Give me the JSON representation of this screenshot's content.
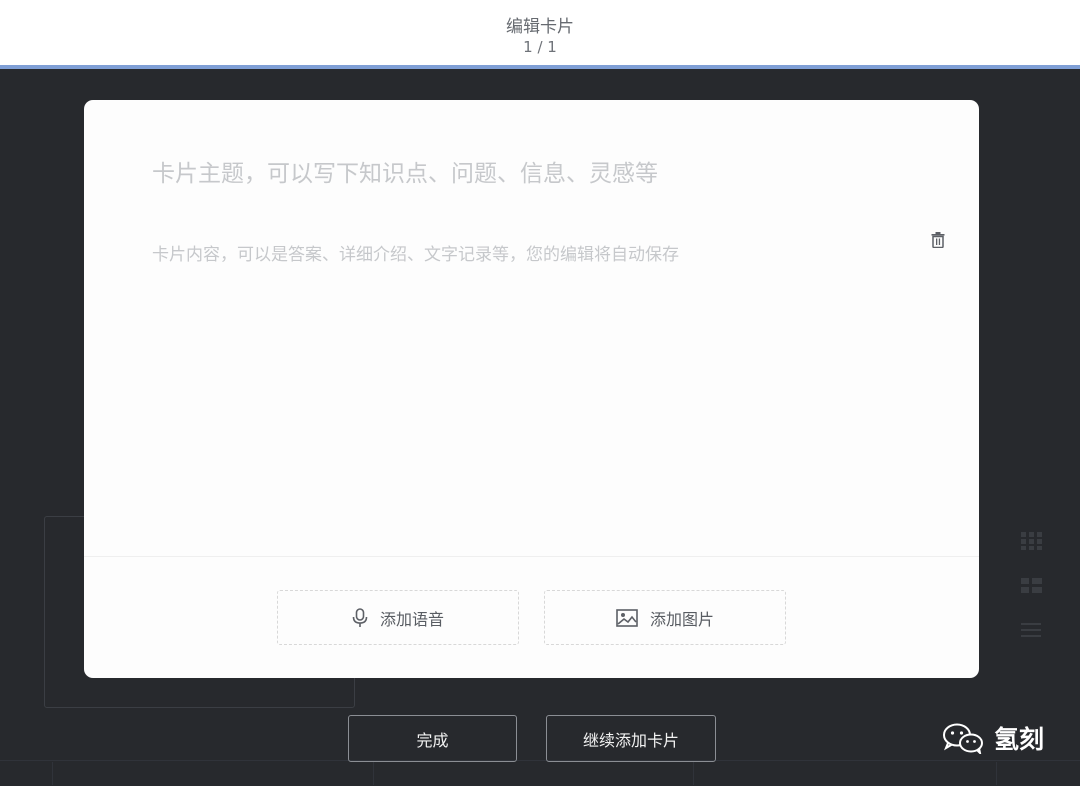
{
  "header": {
    "title": "编辑卡片",
    "page_counter": "1 / 1"
  },
  "editor": {
    "title_placeholder": "卡片主题，可以写下知识点、问题、信息、灵感等",
    "content_placeholder": "卡片内容，可以是答案、详细介绍、文字记录等，您的编辑将自动保存",
    "delete_icon": "trash-icon"
  },
  "attachments": {
    "voice_label": "添加语音",
    "voice_icon": "microphone-icon",
    "image_label": "添加图片",
    "image_icon": "image-icon"
  },
  "actions": {
    "done_label": "完成",
    "continue_label": "继续添加卡片"
  },
  "watermark": {
    "icon": "wechat-icon",
    "text": "氢刻"
  },
  "colors": {
    "accent_line": "#7f9fd6",
    "backdrop": "#27292d",
    "modal": "#fdfdfd"
  }
}
